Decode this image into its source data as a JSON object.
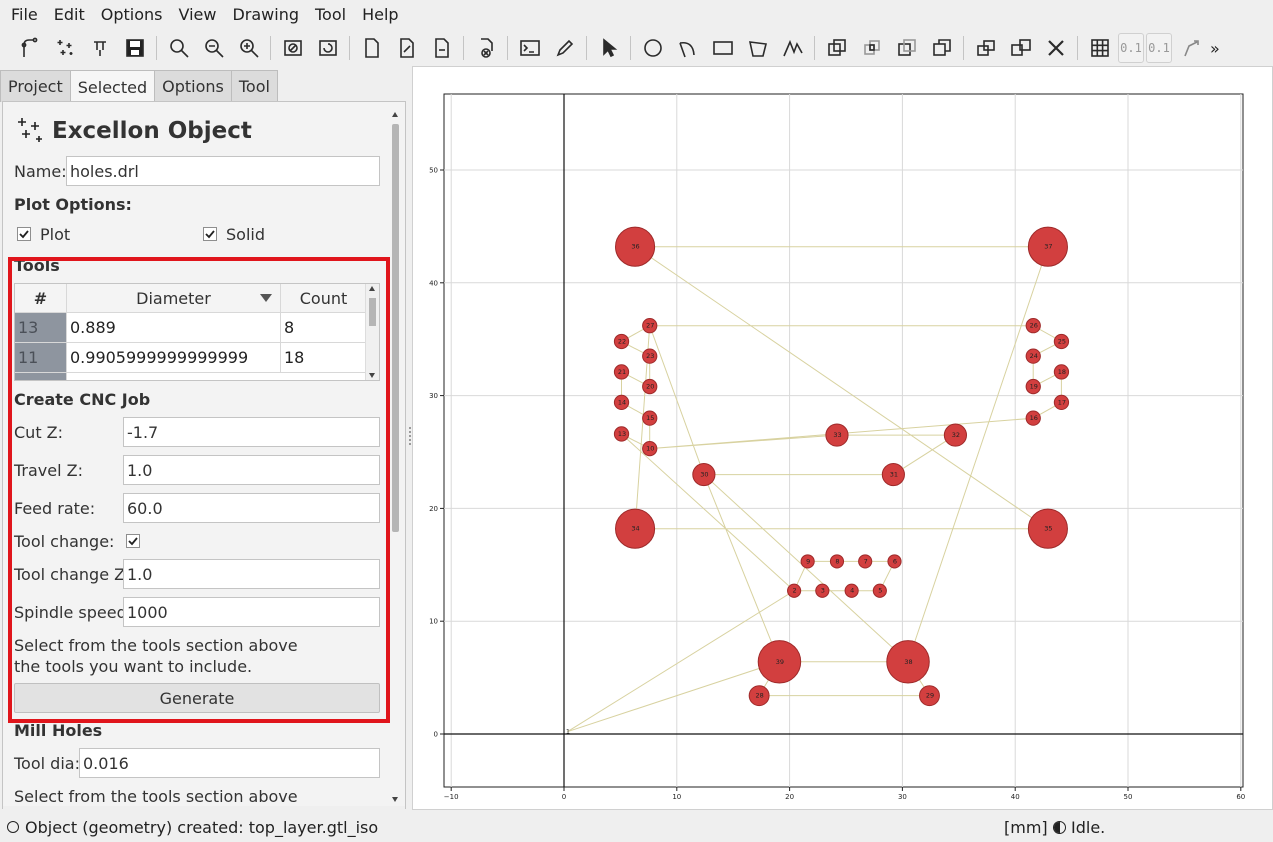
{
  "menu": [
    "File",
    "Edit",
    "Options",
    "View",
    "Drawing",
    "Tool",
    "Help"
  ],
  "toolbar": {
    "text_buttons": [
      "0.1",
      "0.1"
    ],
    "overflow": "»"
  },
  "tabs": [
    "Project",
    "Selected",
    "Options",
    "Tool"
  ],
  "active_tab": "Selected",
  "panel": {
    "title": "Excellon Object",
    "name_label": "Name:",
    "name_value": "holes.drl",
    "plot_options_label": "Plot Options:",
    "plot_label": "Plot",
    "plot_checked": true,
    "solid_label": "Solid",
    "solid_checked": true,
    "tools_label": "Tools",
    "tools_table": {
      "headers": [
        "#",
        "Diameter",
        "Count"
      ],
      "rows": [
        {
          "id": "13",
          "diameter": "0.889",
          "count": "8"
        },
        {
          "id": "11",
          "diameter": "0.9905999999999999",
          "count": "18"
        }
      ]
    },
    "cnc_job_label": "Create CNC Job",
    "cut_z_label": "Cut Z:",
    "cut_z_value": "-1.7",
    "travel_z_label": "Travel Z:",
    "travel_z_value": "1.0",
    "feed_rate_label": "Feed rate:",
    "feed_rate_value": "60.0",
    "tool_change_label": "Tool change:",
    "tool_change_checked": true,
    "tool_change_z_label": "Tool change Z:",
    "tool_change_z_value": "1.0",
    "spindle_speed_label": "Spindle speed:",
    "spindle_speed_value": "1000",
    "select_hint_line1": "Select from the tools section above",
    "select_hint_line2": "the tools you want to include.",
    "generate_label": "Generate",
    "mill_holes_label": "Mill Holes",
    "tool_dia_label": "Tool dia:",
    "tool_dia_value": "0.016",
    "mill_hint": "Select from the tools section above"
  },
  "plot": {
    "x_ticks": [
      "−10",
      "0",
      "10",
      "20",
      "30",
      "40",
      "50",
      "60"
    ],
    "y_ticks": [
      "0",
      "10",
      "20",
      "30",
      "40",
      "50"
    ],
    "colors": {
      "hole_fill": "#d23f3f",
      "hole_stroke": "#9e2a2a",
      "path": "#d8d2a0",
      "grid": "#d9d9d9"
    },
    "holes": [
      {
        "id": "1",
        "x": 0.3,
        "y": 0.2,
        "d": 0
      },
      {
        "id": "2",
        "x": 20.4,
        "y": 12.7,
        "d": 0.9
      },
      {
        "id": "3",
        "x": 22.9,
        "y": 12.7,
        "d": 0.9
      },
      {
        "id": "4",
        "x": 25.5,
        "y": 12.7,
        "d": 0.9
      },
      {
        "id": "5",
        "x": 28.0,
        "y": 12.7,
        "d": 0.9
      },
      {
        "id": "6",
        "x": 29.3,
        "y": 15.3,
        "d": 0.9
      },
      {
        "id": "7",
        "x": 26.7,
        "y": 15.3,
        "d": 0.9
      },
      {
        "id": "8",
        "x": 24.2,
        "y": 15.3,
        "d": 0.9
      },
      {
        "id": "9",
        "x": 21.6,
        "y": 15.3,
        "d": 0.9
      },
      {
        "id": "10",
        "x": 7.6,
        "y": 25.3,
        "d": 1.0
      },
      {
        "id": "13",
        "x": 5.1,
        "y": 26.6,
        "d": 1.0
      },
      {
        "id": "14",
        "x": 5.1,
        "y": 29.4,
        "d": 1.0
      },
      {
        "id": "15",
        "x": 7.6,
        "y": 28.0,
        "d": 1.0
      },
      {
        "id": "16",
        "x": 41.6,
        "y": 28.0,
        "d": 1.0
      },
      {
        "id": "17",
        "x": 44.1,
        "y": 29.4,
        "d": 1.0
      },
      {
        "id": "18",
        "x": 44.1,
        "y": 32.1,
        "d": 1.0
      },
      {
        "id": "19",
        "x": 41.6,
        "y": 30.8,
        "d": 1.0
      },
      {
        "id": "20",
        "x": 7.6,
        "y": 30.8,
        "d": 1.0
      },
      {
        "id": "21",
        "x": 5.1,
        "y": 32.1,
        "d": 1.0
      },
      {
        "id": "22",
        "x": 5.1,
        "y": 34.8,
        "d": 1.0
      },
      {
        "id": "23",
        "x": 7.6,
        "y": 33.5,
        "d": 1.0
      },
      {
        "id": "24",
        "x": 41.6,
        "y": 33.5,
        "d": 1.0
      },
      {
        "id": "25",
        "x": 44.1,
        "y": 34.8,
        "d": 1.0
      },
      {
        "id": "26",
        "x": 41.6,
        "y": 36.2,
        "d": 1.0
      },
      {
        "id": "27",
        "x": 7.6,
        "y": 36.2,
        "d": 1.0
      },
      {
        "id": "28",
        "x": 17.3,
        "y": 3.4,
        "d": 1.5
      },
      {
        "id": "29",
        "x": 32.4,
        "y": 3.4,
        "d": 1.5
      },
      {
        "id": "30",
        "x": 12.4,
        "y": 23.0,
        "d": 1.7
      },
      {
        "id": "31",
        "x": 29.2,
        "y": 23.0,
        "d": 1.7
      },
      {
        "id": "32",
        "x": 34.7,
        "y": 26.5,
        "d": 1.7
      },
      {
        "id": "33",
        "x": 24.2,
        "y": 26.5,
        "d": 1.7
      },
      {
        "id": "34",
        "x": 6.3,
        "y": 18.2,
        "d": 3.2
      },
      {
        "id": "35",
        "x": 42.9,
        "y": 18.2,
        "d": 3.2
      },
      {
        "id": "36",
        "x": 6.3,
        "y": 43.2,
        "d": 3.2
      },
      {
        "id": "37",
        "x": 42.9,
        "y": 43.2,
        "d": 3.2
      },
      {
        "id": "38",
        "x": 30.5,
        "y": 6.4,
        "d": 3.5
      },
      {
        "id": "39",
        "x": 19.1,
        "y": 6.4,
        "d": 3.5
      }
    ],
    "path_order": [
      "1",
      "2",
      "3",
      "4",
      "5",
      "6",
      "7",
      "8",
      "9",
      "2",
      "13",
      "10",
      "15",
      "14",
      "21",
      "20",
      "23",
      "22",
      "27",
      "26",
      "25",
      "24",
      "19",
      "18",
      "17",
      "16",
      "10",
      "33",
      "32",
      "31",
      "30",
      "39",
      "28",
      "29",
      "38",
      "30",
      "27",
      "34",
      "35",
      "36",
      "37",
      "38",
      "39",
      "1"
    ]
  },
  "status": {
    "message": "Object (geometry) created: top_layer.gtl_iso",
    "units": "[mm]",
    "state": "Idle."
  }
}
